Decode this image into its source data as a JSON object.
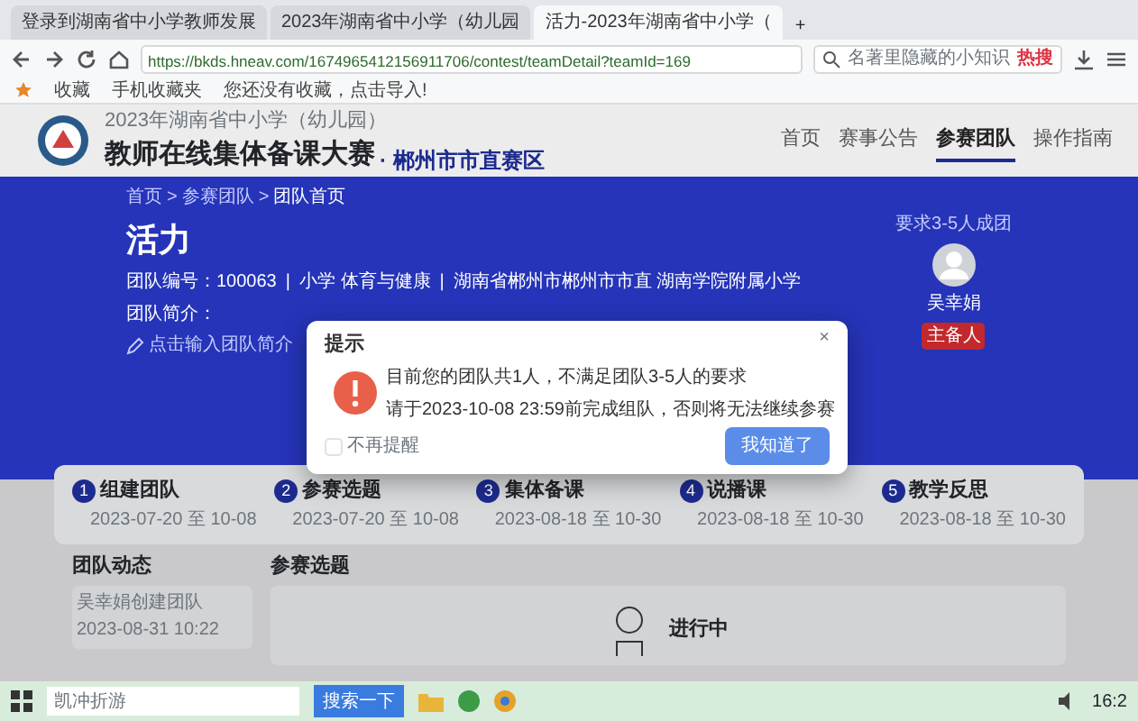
{
  "browser": {
    "tabs": [
      {
        "title": "登录到湖南省中小学教师发展",
        "selected": false
      },
      {
        "title": "2023年湖南省中小学（幼儿园",
        "selected": false
      },
      {
        "title": "活力-2023年湖南省中小学（",
        "selected": true
      }
    ],
    "new_tab": "+",
    "url": "https://bkds.hneav.com/1674965412156911706/contest/teamDetail?teamId=169",
    "search": {
      "placeholder": "名著里隐藏的小知识",
      "hot": "热搜"
    },
    "bookmarks": [
      "收藏",
      "手机收藏夹",
      "您还没有收藏，点击导入!"
    ]
  },
  "site": {
    "year_line": "2023年湖南省中小学（幼儿园）",
    "title": "教师在线集体备课大赛",
    "region": "· 郴州市市直赛区",
    "nav": [
      {
        "label": "首页",
        "selected": false
      },
      {
        "label": "赛事公告",
        "selected": false
      },
      {
        "label": "参赛团队",
        "selected": true
      },
      {
        "label": "操作指南",
        "selected": false
      }
    ]
  },
  "hero": {
    "breadcrumb": [
      "首页",
      "参赛团队",
      "团队首页"
    ],
    "breadcrumb_separator": ">",
    "meta_separator": "|",
    "team_name": "活力",
    "meta": [
      "团队编号：100063",
      "小学 体育与健康",
      "湖南省郴州市郴州市市直 湖南学院附属小学"
    ],
    "intro_label": "团队简介：",
    "intro_placeholder": "点击输入团队简介",
    "requirement": "要求3-5人成团",
    "member": {
      "name": "吴幸娟",
      "role": "主备人"
    }
  },
  "steps": [
    {
      "number": "1",
      "label": "组建团队",
      "dates": "2023-07-20 至 10-08"
    },
    {
      "number": "2",
      "label": "参赛选题",
      "dates": "2023-07-20 至 10-08"
    },
    {
      "number": "3",
      "label": "集体备课",
      "dates": "2023-08-18 至 10-30"
    },
    {
      "number": "4",
      "label": "说播课",
      "dates": "2023-08-18 至 10-30"
    },
    {
      "number": "5",
      "label": "教学反思",
      "dates": "2023-08-18 至 10-30"
    }
  ],
  "activity": {
    "title": "团队动态",
    "items": [
      {
        "text": "吴幸娟创建团队",
        "time": "2023-08-31 10:22"
      }
    ]
  },
  "topic": {
    "title": "参赛选题",
    "status": "进行中"
  },
  "dialog": {
    "title": "提示",
    "close": "×",
    "lines": [
      "目前您的团队共1人，不满足团队3-5人的要求",
      "请于2023-10-08 23:59前完成组队，否则将无法继续参赛"
    ],
    "checkbox": {
      "label": "不再提醒",
      "checked": false
    },
    "button": "我知道了"
  },
  "taskbar": {
    "search_text": "凯冲折游",
    "search_button": "搜索一下",
    "clock": "16:2"
  }
}
